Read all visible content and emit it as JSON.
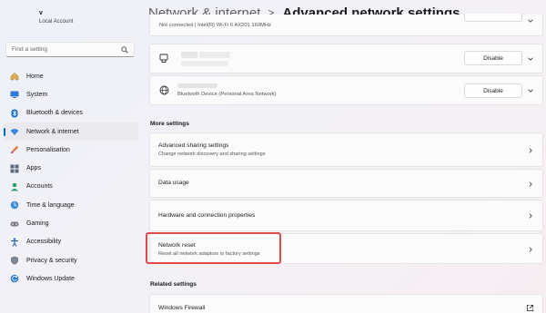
{
  "user": {
    "name": "v",
    "account_type": "Local Account"
  },
  "search": {
    "placeholder": "Find a setting"
  },
  "nav": [
    {
      "label": "Home",
      "icon": "home-icon"
    },
    {
      "label": "System",
      "icon": "monitor-icon"
    },
    {
      "label": "Bluetooth & devices",
      "icon": "bluetooth-icon"
    },
    {
      "label": "Network & internet",
      "icon": "wifi-icon",
      "active": true
    },
    {
      "label": "Personalisation",
      "icon": "brush-icon"
    },
    {
      "label": "Apps",
      "icon": "apps-icon"
    },
    {
      "label": "Accounts",
      "icon": "person-icon"
    },
    {
      "label": "Time & language",
      "icon": "clock-globe-icon"
    },
    {
      "label": "Gaming",
      "icon": "gamepad-icon"
    },
    {
      "label": "Accessibility",
      "icon": "accessibility-icon"
    },
    {
      "label": "Privacy & security",
      "icon": "shield-icon"
    },
    {
      "label": "Windows Update",
      "icon": "update-icon"
    }
  ],
  "breadcrumb": {
    "parent": "Network & internet",
    "separator": ">",
    "current": "Advanced network settings"
  },
  "adapters": [
    {
      "subtitle": "Not connected | Intel(R) Wi-Fi 6 AX201 160MHz",
      "button": "Disable"
    },
    {
      "title": "",
      "subtitle": "",
      "button": "Disable",
      "icon": "ethernet-icon"
    },
    {
      "title": "",
      "subtitle": "Bluetooth Device (Personal Area Network)",
      "button": "Disable",
      "icon": "globe-icon"
    }
  ],
  "more_settings": {
    "heading": "More settings",
    "items": [
      {
        "title": "Advanced sharing settings",
        "subtitle": "Change network discovery and sharing settings"
      },
      {
        "title": "Data usage",
        "subtitle": ""
      },
      {
        "title": "Hardware and connection properties",
        "subtitle": ""
      },
      {
        "title": "Network reset",
        "subtitle": "Reset all network adaptors to factory settings",
        "highlighted": true
      }
    ]
  },
  "related_settings": {
    "heading": "Related settings",
    "items": [
      {
        "title": "Windows Firewall",
        "icon": "external-link-icon"
      }
    ]
  },
  "colors": {
    "accent": "#0067c0",
    "highlight": "#e04a4a"
  }
}
